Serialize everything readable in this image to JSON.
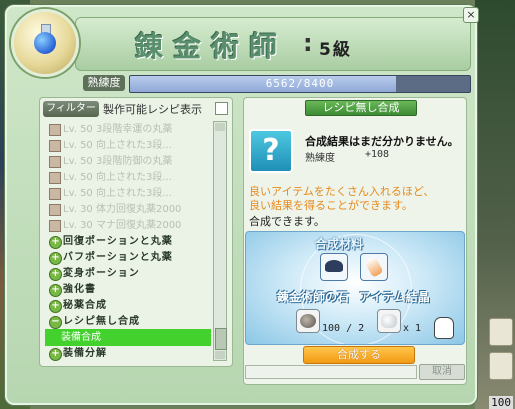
{
  "window": {
    "title": "錬金術師",
    "level_suffix": "5級"
  },
  "skill": {
    "label": "熟練度",
    "text": "6562/8400",
    "fill_fraction": 0.781
  },
  "filter": {
    "button_label": "フィルター",
    "title": "製作可能レシピ表示"
  },
  "recipes": [
    {
      "kind": "item",
      "label": "Lv. 50 3段階幸運の丸薬"
    },
    {
      "kind": "item",
      "label": "Lv. 50 向上された3段..."
    },
    {
      "kind": "item",
      "label": "Lv. 50 3段階防御の丸薬"
    },
    {
      "kind": "item",
      "label": "Lv. 50 向上された3段..."
    },
    {
      "kind": "item",
      "label": "Lv. 50 向上された3段..."
    },
    {
      "kind": "item",
      "label": "Lv. 30 体力回復丸薬2000"
    },
    {
      "kind": "item",
      "label": "Lv. 30 マナ回復丸薬2000"
    },
    {
      "kind": "category",
      "label": "回復ポーションと丸薬"
    },
    {
      "kind": "category",
      "label": "バフポーションと丸薬"
    },
    {
      "kind": "category",
      "label": "変身ポーション"
    },
    {
      "kind": "category",
      "label": "強化書"
    },
    {
      "kind": "category",
      "label": "秘薬合成"
    },
    {
      "kind": "category-open",
      "label": "レシピ無し合成"
    },
    {
      "kind": "selected",
      "label": "装備合成"
    },
    {
      "kind": "category",
      "label": "装備分解"
    }
  ],
  "detail": {
    "banner": "レシピ無し合成",
    "result_title": "合成結果はまだ分かりません。",
    "skill_label": "熟練度",
    "skill_value": "+108",
    "desc_line1": "良いアイテムをたくさん入れるほど、",
    "desc_line2": "良い結果を得ることができます。",
    "status": "合成できます。"
  },
  "materials": {
    "title": "合成材料",
    "mat1_label": "錬金術師の石",
    "mat2_label": "アイテム結晶",
    "ing1_count": "100 / 2",
    "ing2_count": "x 1"
  },
  "actions": {
    "craft": "合成する",
    "cancel": "取消"
  },
  "corner_number": "100"
}
